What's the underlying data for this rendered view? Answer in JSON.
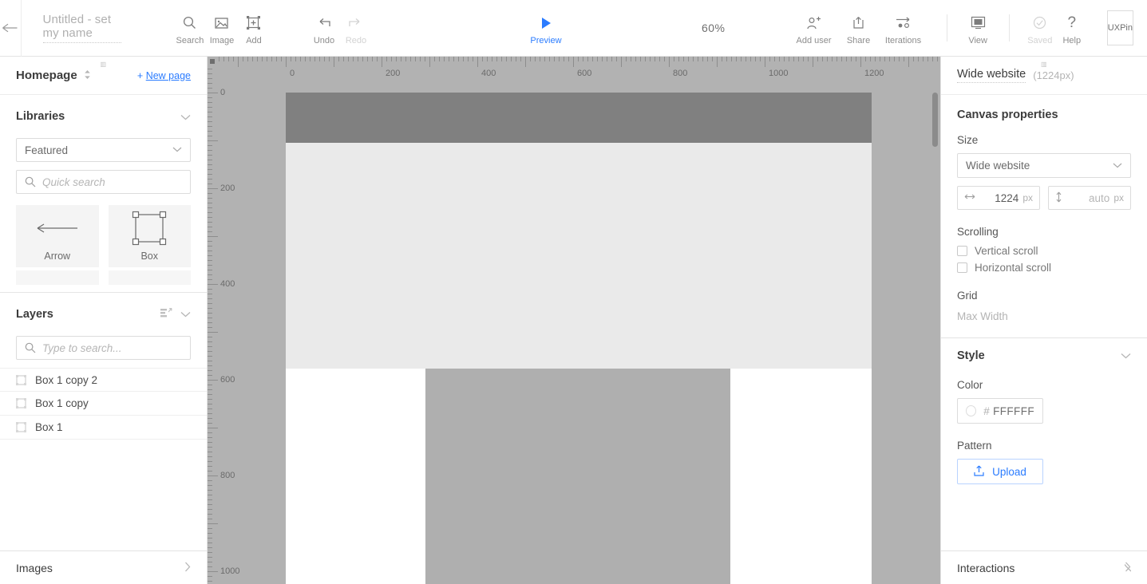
{
  "toolbar": {
    "back_icon": "arrow-left-icon",
    "document_title_placeholder": "Untitled - set my name",
    "document_title": "Untitled - set my name",
    "items": [
      {
        "label": "Search",
        "icon": "search-icon"
      },
      {
        "label": "Image",
        "icon": "image-icon"
      },
      {
        "label": "Add",
        "icon": "add-element-icon"
      }
    ],
    "history": [
      {
        "label": "Undo",
        "icon": "undo-icon",
        "disabled": false
      },
      {
        "label": "Redo",
        "icon": "redo-icon",
        "disabled": true
      }
    ],
    "preview": {
      "label": "Preview",
      "icon": "play-icon"
    },
    "zoom": "60%",
    "collab": [
      {
        "label": "Add user",
        "icon": "add-user-icon"
      },
      {
        "label": "Share",
        "icon": "share-icon"
      },
      {
        "label": "Iterations",
        "icon": "iterations-icon"
      }
    ],
    "view": {
      "label": "View",
      "icon": "monitor-icon"
    },
    "status": [
      {
        "label": "Saved",
        "icon": "check-circle-icon",
        "disabled": true
      },
      {
        "label": "Help",
        "icon": "question-mark-icon",
        "disabled": false
      }
    ],
    "brand": "UXPin"
  },
  "left_panel": {
    "page": {
      "name": "Homepage",
      "new_page_label": "New page",
      "new_page_plus": "+"
    },
    "libraries": {
      "title": "Libraries",
      "category_selected": "Featured",
      "search_placeholder": "Quick search",
      "tiles": [
        {
          "label": "Arrow",
          "icon": "arrow-left-long-icon"
        },
        {
          "label": "Box",
          "icon": "box-handles-icon"
        }
      ]
    },
    "layers": {
      "title": "Layers",
      "search_placeholder": "Type to search...",
      "items": [
        {
          "label": "Box 1 copy 2",
          "icon": "box-layer-icon"
        },
        {
          "label": "Box 1 copy",
          "icon": "box-layer-icon"
        },
        {
          "label": "Box 1",
          "icon": "box-layer-icon"
        }
      ]
    },
    "footer": {
      "label": "Images",
      "chevron": "›"
    }
  },
  "canvas": {
    "ruler_h_labels": [
      "0",
      "200",
      "400",
      "600",
      "800",
      "1000",
      "1200"
    ],
    "ruler_v_labels": [
      "0",
      "200",
      "400",
      "600",
      "800"
    ],
    "zoom_percent": 60,
    "shapes": [
      {
        "name": "header-bar",
        "color": "#808080"
      },
      {
        "name": "hero-box",
        "color": "#eaeaea"
      },
      {
        "name": "content-box",
        "color": "#afafaf"
      }
    ],
    "page_background": "#ffffff"
  },
  "right_panel": {
    "header": {
      "title": "Wide website",
      "subtitle": "(1224px)"
    },
    "canvas_properties": {
      "title": "Canvas properties",
      "size_label": "Size",
      "size_selected": "Wide website",
      "width_value": "1224",
      "width_unit": "px",
      "height_value": "auto",
      "height_unit": "px",
      "scrolling_label": "Scrolling",
      "vertical_scroll_label": "Vertical scroll",
      "horizontal_scroll_label": "Horizontal scroll",
      "grid_label": "Grid",
      "max_width_label": "Max Width"
    },
    "style": {
      "title": "Style",
      "color_label": "Color",
      "color_hash": "#",
      "color_hex": "FFFFFF",
      "pattern_label": "Pattern",
      "upload_label": "Upload"
    },
    "footer": {
      "label": "Interactions",
      "chevron": "›"
    }
  },
  "colors": {
    "accent": "#2b7cff",
    "canvas_bg": "#b2b2b2",
    "panel_bg": "#ffffff",
    "text": "#4a4a4a"
  }
}
